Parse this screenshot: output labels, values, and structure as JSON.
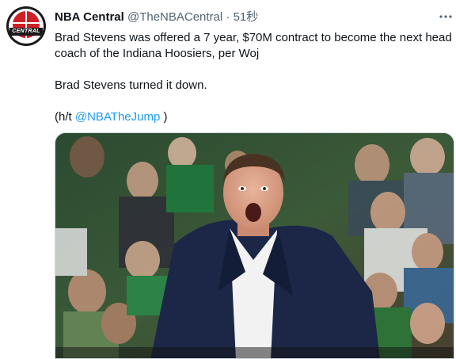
{
  "tweet": {
    "display_name": "NBA Central",
    "handle": "@TheNBACentral",
    "separator": "·",
    "timestamp": "51秒",
    "more_icon": "more-horizontal-icon",
    "text_line1": "Brad Stevens was offered a 7 year, $70M contract to become the next head",
    "text_line2": "coach of the Indiana Hoosiers, per Woj",
    "text_line3": "Brad Stevens turned it down.",
    "text_line4_prefix": "(h/t ",
    "text_line4_mention": "@NBATheJump",
    "text_line4_suffix": " )"
  },
  "avatar": {
    "logo_text": "CENTRAL"
  },
  "colors": {
    "text": "#0f1419",
    "secondary": "#536471",
    "link": "#1d9bf0",
    "brand_red": "#cf2027"
  }
}
